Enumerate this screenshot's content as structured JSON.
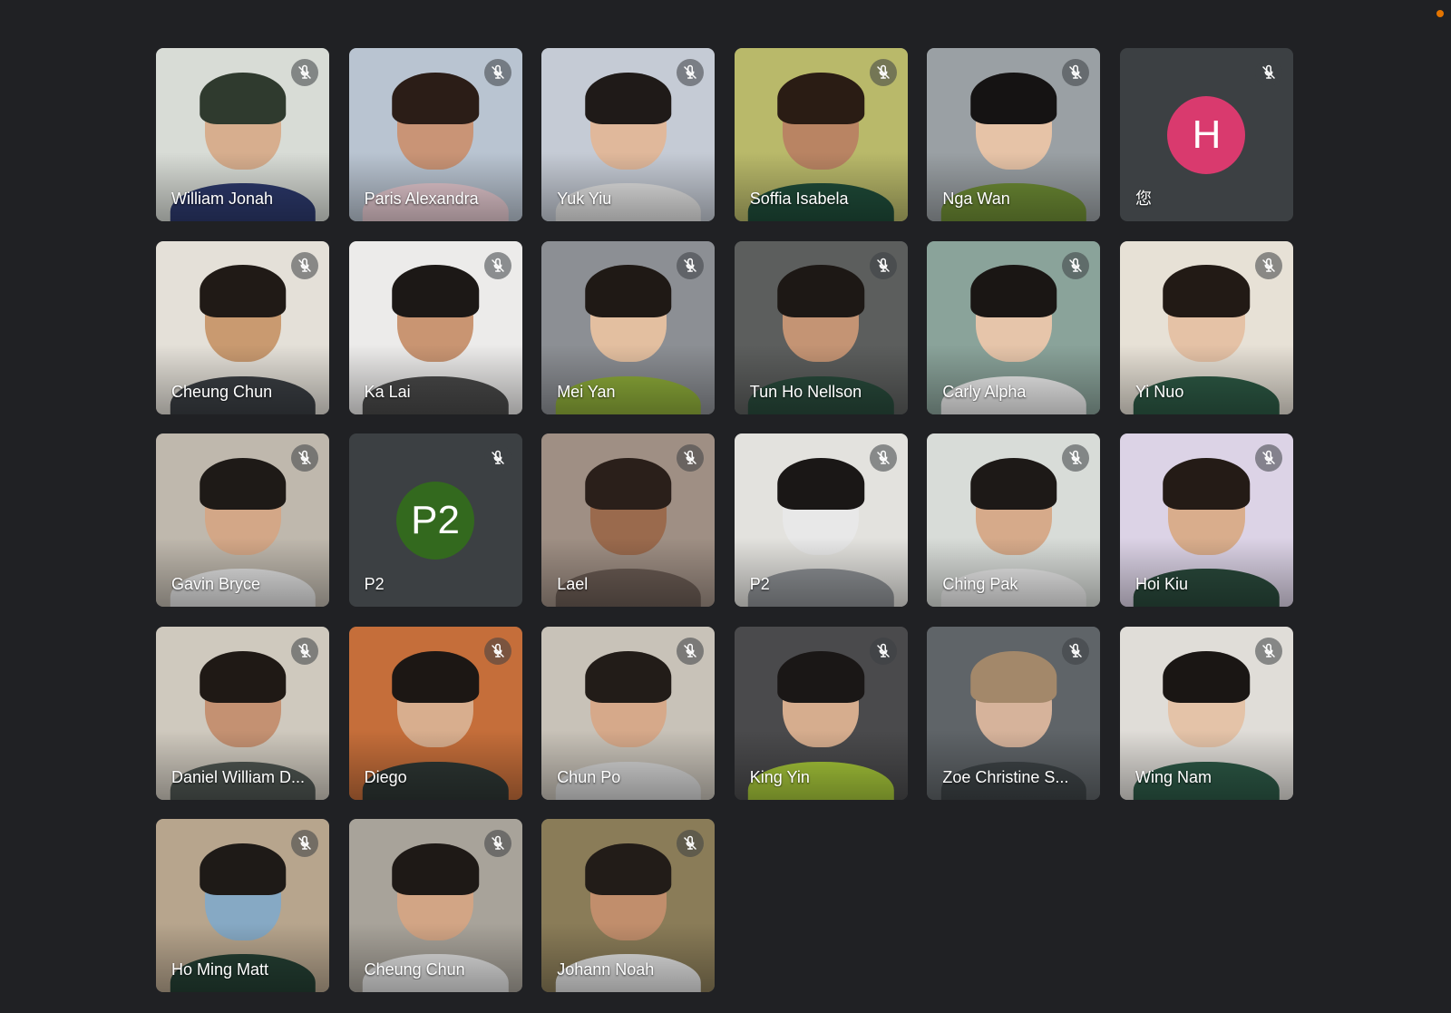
{
  "colors": {
    "background": "#202124",
    "tile_background": "#3c4043",
    "recording_dot": "#e37400"
  },
  "participants": [
    {
      "name": "William Jonah",
      "muted": true,
      "video": true,
      "bg": "#d8dcd6",
      "hair": "#2f3a2e",
      "skin": "#d7ae8e",
      "shirt": "#2d3a6e"
    },
    {
      "name": "Paris Alexandra",
      "muted": true,
      "video": true,
      "bg": "#b9c4d1",
      "hair": "#2b1d17",
      "skin": "#c99476",
      "shirt": "#e7cbd2"
    },
    {
      "name": "Yuk Yiu",
      "muted": true,
      "video": true,
      "bg": "#c5cbd5",
      "hair": "#1f1a18",
      "skin": "#e0b89b",
      "shirt": "#e6e6e6"
    },
    {
      "name": "Soffia Isabela",
      "muted": true,
      "video": true,
      "bg": "#b9b96a",
      "hair": "#2a1c14",
      "skin": "#b98463",
      "shirt": "#1f4d3a"
    },
    {
      "name": "Nga Wan",
      "muted": true,
      "video": true,
      "bg": "#9aa0a4",
      "hair": "#151313",
      "skin": "#e6c3a7",
      "shirt": "#6f8e35"
    },
    {
      "name": "您",
      "muted": true,
      "video": false,
      "avatar": "H",
      "avatar_color": "#d93a6e"
    },
    {
      "name": "Cheung Chun",
      "muted": true,
      "video": true,
      "bg": "#e4e0d8",
      "hair": "#201a16",
      "skin": "#c99a70",
      "shirt": "#3b3f44"
    },
    {
      "name": "Ka Lai",
      "muted": true,
      "video": true,
      "bg": "#ecebea",
      "hair": "#1c1816",
      "skin": "#c99572",
      "shirt": "#4a4a4a"
    },
    {
      "name": "Mei Yan",
      "muted": true,
      "video": true,
      "bg": "#8c8f94",
      "hair": "#1f1915",
      "skin": "#e3bfa0",
      "shirt": "#8fae3a"
    },
    {
      "name": "Tun Ho Nellson",
      "muted": true,
      "video": true,
      "bg": "#5c5e5d",
      "hair": "#1d1815",
      "skin": "#c49474",
      "shirt": "#294b3c"
    },
    {
      "name": "Carly Alpha",
      "muted": true,
      "video": true,
      "bg": "#8aa39a",
      "hair": "#1a1614",
      "skin": "#e6c5aa",
      "shirt": "#f1f1f1"
    },
    {
      "name": "Yi Nuo",
      "muted": true,
      "video": true,
      "bg": "#e7e1d6",
      "hair": "#221a15",
      "skin": "#e5c2a6",
      "shirt": "#2d5a45"
    },
    {
      "name": "Gavin Bryce",
      "muted": true,
      "video": true,
      "bg": "#bfb8ad",
      "hair": "#1e1a17",
      "skin": "#d3a787",
      "shirt": "#e4e4e4"
    },
    {
      "name": "P2",
      "muted": true,
      "video": false,
      "avatar": "P2",
      "avatar_color": "#33691e"
    },
    {
      "name": "Lael",
      "muted": true,
      "video": true,
      "bg": "#9f8f84",
      "hair": "#2a1f1a",
      "skin": "#9a6a4d",
      "shirt": "#6b5c54"
    },
    {
      "name": "P2",
      "muted": true,
      "video": true,
      "bg": "#e3e2de",
      "hair": "#1a1716",
      "skin": "#e8e8e8",
      "shirt": "#8f9296"
    },
    {
      "name": "Ching Pak",
      "muted": true,
      "video": true,
      "bg": "#d8dcd8",
      "hair": "#1d1917",
      "skin": "#d6aa8a",
      "shirt": "#ececec"
    },
    {
      "name": "Hoi Kiu",
      "muted": true,
      "video": true,
      "bg": "#dcd3e6",
      "hair": "#241b16",
      "skin": "#d9ad8c",
      "shirt": "#2a4a3c"
    },
    {
      "name": "Daniel William D...",
      "muted": true,
      "video": true,
      "bg": "#cfc9be",
      "hair": "#1f1915",
      "skin": "#c49172",
      "shirt": "#4f5652"
    },
    {
      "name": "Diego",
      "muted": true,
      "video": true,
      "bg": "#c56e3a",
      "hair": "#1c1714",
      "skin": "#d8ae8e",
      "shirt": "#2e3734"
    },
    {
      "name": "Chun Po",
      "muted": true,
      "video": true,
      "bg": "#c8c2b8",
      "hair": "#221c18",
      "skin": "#d6a98a",
      "shirt": "#d8d8d8"
    },
    {
      "name": "King Yin",
      "muted": true,
      "video": true,
      "bg": "#4a4a4c",
      "hair": "#1a1716",
      "skin": "#d6ad8e",
      "shirt": "#a8c93a"
    },
    {
      "name": "Zoe Christine S...",
      "muted": true,
      "video": true,
      "bg": "#5f6468",
      "hair": "#a3886a",
      "skin": "#d6b39b",
      "shirt": "#3e4447"
    },
    {
      "name": "Wing Nam",
      "muted": true,
      "video": true,
      "bg": "#e0ddd8",
      "hair": "#1a1614",
      "skin": "#e4c3a8",
      "shirt": "#2d5a47"
    },
    {
      "name": "Ho Ming Matt",
      "muted": true,
      "video": true,
      "bg": "#b7a58d",
      "hair": "#1e1a17",
      "skin": "#86a9c4",
      "shirt": "#243f33"
    },
    {
      "name": "Cheung Chun",
      "muted": true,
      "video": true,
      "bg": "#a8a39a",
      "hair": "#1e1916",
      "skin": "#d2a585",
      "shirt": "#e2e2e2"
    },
    {
      "name": "Johann Noah",
      "muted": true,
      "video": true,
      "bg": "#8a7c58",
      "hair": "#221c18",
      "skin": "#c18e6c",
      "shirt": "#e4e4e4"
    }
  ]
}
